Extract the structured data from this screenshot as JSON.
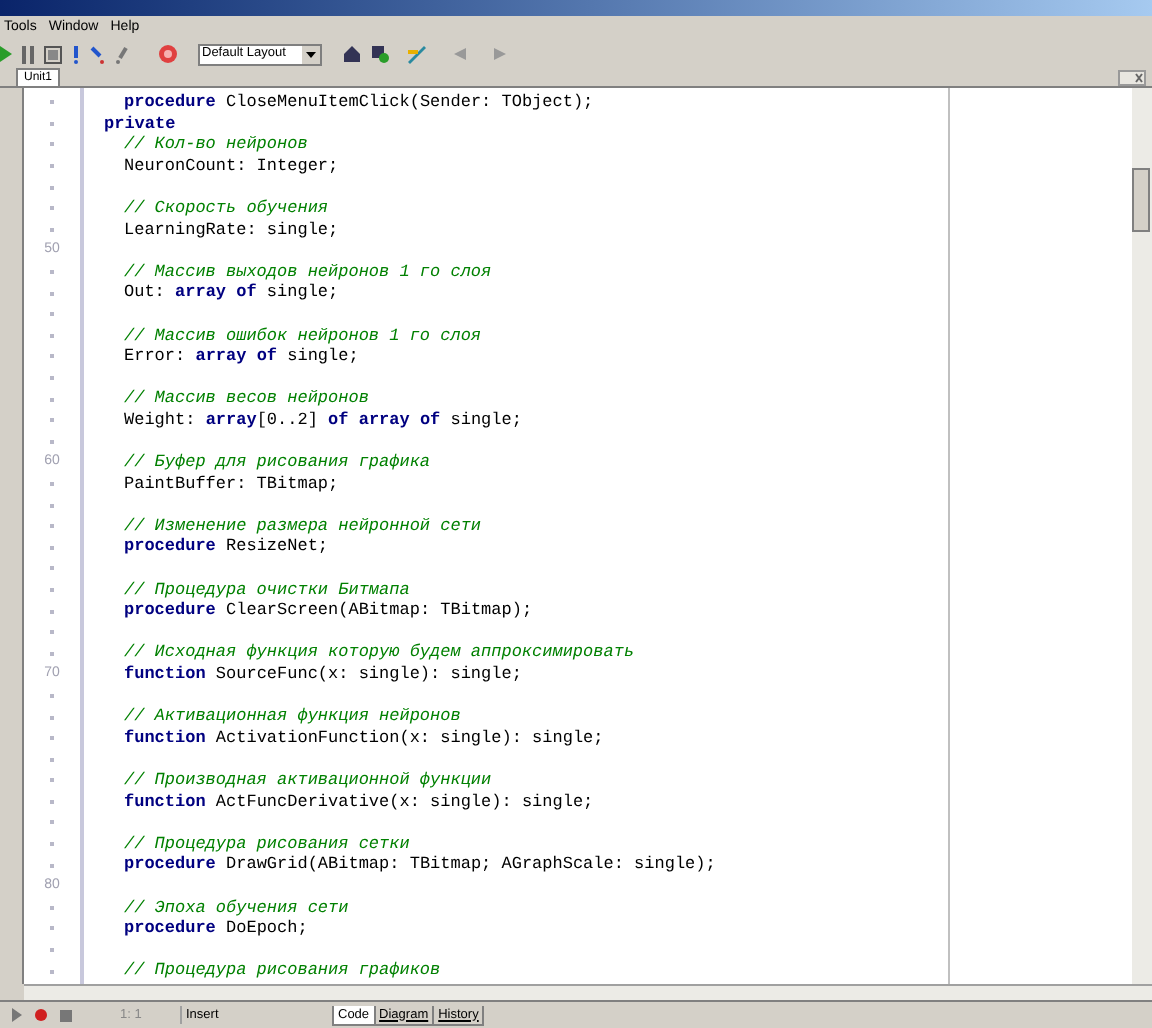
{
  "menu": [
    {
      "label": "Tools"
    },
    {
      "label": "Window"
    },
    {
      "label": "Help"
    }
  ],
  "toolbar": {
    "layout_combo": {
      "value": "Default Layout"
    }
  },
  "editor_tabs": [
    {
      "label": "Unit1",
      "selected": true
    }
  ],
  "lines": [
    {
      "kind": "member",
      "tokens": [
        {
          "kind": "keyword",
          "text": "procedure"
        },
        {
          "kind": "text",
          "text": " CloseMenuItemClick(Sender: TObject);"
        }
      ]
    },
    {
      "kind": "section",
      "tokens": [
        {
          "kind": "keyword",
          "text": "private"
        }
      ]
    },
    {
      "kind": "member",
      "tokens": [
        {
          "kind": "comment",
          "text": "// Кол-во нейронов"
        }
      ]
    },
    {
      "kind": "member",
      "tokens": [
        {
          "kind": "text",
          "text": "NeuronCount: Integer;"
        }
      ]
    },
    {
      "kind": "blank"
    },
    {
      "kind": "member",
      "tokens": [
        {
          "kind": "comment",
          "text": "// Скорость обучения"
        }
      ]
    },
    {
      "kind": "member",
      "tokens": [
        {
          "kind": "text",
          "text": "LearningRate: single;"
        }
      ]
    },
    {
      "kind": "blank",
      "number": "50"
    },
    {
      "kind": "member",
      "tokens": [
        {
          "kind": "comment",
          "text": "// Массив выходов нейронов 1 го слоя"
        }
      ]
    },
    {
      "kind": "member",
      "tokens": [
        {
          "kind": "text",
          "text": "Out: "
        },
        {
          "kind": "keyword",
          "text": "array of"
        },
        {
          "kind": "text",
          "text": " single;"
        }
      ]
    },
    {
      "kind": "blank"
    },
    {
      "kind": "member",
      "tokens": [
        {
          "kind": "comment",
          "text": "// Массив ошибок нейронов 1 го слоя"
        }
      ]
    },
    {
      "kind": "member",
      "tokens": [
        {
          "kind": "text",
          "text": "Error: "
        },
        {
          "kind": "keyword",
          "text": "array of"
        },
        {
          "kind": "text",
          "text": " single;"
        }
      ]
    },
    {
      "kind": "blank"
    },
    {
      "kind": "member",
      "tokens": [
        {
          "kind": "comment",
          "text": "// Массив весов нейронов"
        }
      ]
    },
    {
      "kind": "member",
      "tokens": [
        {
          "kind": "text",
          "text": "Weight: "
        },
        {
          "kind": "keyword",
          "text": "array"
        },
        {
          "kind": "text",
          "text": "[0..2] "
        },
        {
          "kind": "keyword",
          "text": "of array of"
        },
        {
          "kind": "text",
          "text": " single;"
        }
      ]
    },
    {
      "kind": "blank"
    },
    {
      "kind": "member",
      "number": "60",
      "tokens": [
        {
          "kind": "comment",
          "text": "// Буфер для рисования графика"
        }
      ]
    },
    {
      "kind": "member",
      "tokens": [
        {
          "kind": "text",
          "text": "PaintBuffer: TBitmap;"
        }
      ]
    },
    {
      "kind": "blank"
    },
    {
      "kind": "member",
      "tokens": [
        {
          "kind": "comment",
          "text": "// Изменение размера нейронной сети"
        }
      ]
    },
    {
      "kind": "member",
      "tokens": [
        {
          "kind": "keyword",
          "text": "procedure"
        },
        {
          "kind": "text",
          "text": " ResizeNet;"
        }
      ]
    },
    {
      "kind": "blank"
    },
    {
      "kind": "member",
      "tokens": [
        {
          "kind": "comment",
          "text": "// Процедура очистки Битмапа"
        }
      ]
    },
    {
      "kind": "member",
      "tokens": [
        {
          "kind": "keyword",
          "text": "procedure"
        },
        {
          "kind": "text",
          "text": " ClearScreen(ABitmap: TBitmap);"
        }
      ]
    },
    {
      "kind": "blank"
    },
    {
      "kind": "member",
      "tokens": [
        {
          "kind": "comment",
          "text": "// Исходная функция которую будем аппроксимировать"
        }
      ]
    },
    {
      "kind": "member",
      "number": "70",
      "tokens": [
        {
          "kind": "keyword",
          "text": "function"
        },
        {
          "kind": "text",
          "text": " SourceFunc(x: single): single;"
        }
      ]
    },
    {
      "kind": "blank"
    },
    {
      "kind": "member",
      "tokens": [
        {
          "kind": "comment",
          "text": "// Активационная функция нейронов"
        }
      ]
    },
    {
      "kind": "member",
      "tokens": [
        {
          "kind": "keyword",
          "text": "function"
        },
        {
          "kind": "text",
          "text": " ActivationFunction(x: single): single;"
        }
      ]
    },
    {
      "kind": "blank"
    },
    {
      "kind": "member",
      "tokens": [
        {
          "kind": "comment",
          "text": "// Производная активационной функции"
        }
      ]
    },
    {
      "kind": "member",
      "tokens": [
        {
          "kind": "keyword",
          "text": "function"
        },
        {
          "kind": "text",
          "text": " ActFuncDerivative(x: single): single;"
        }
      ]
    },
    {
      "kind": "blank"
    },
    {
      "kind": "member",
      "tokens": [
        {
          "kind": "comment",
          "text": "// Процедура рисования сетки"
        }
      ]
    },
    {
      "kind": "member",
      "tokens": [
        {
          "kind": "keyword",
          "text": "procedure"
        },
        {
          "kind": "text",
          "text": " DrawGrid(ABitmap: TBitmap; AGraphScale: single);"
        }
      ]
    },
    {
      "kind": "blank",
      "number": "80"
    },
    {
      "kind": "member",
      "tokens": [
        {
          "kind": "comment",
          "text": "// Эпоха обучения сети"
        }
      ]
    },
    {
      "kind": "member",
      "tokens": [
        {
          "kind": "keyword",
          "text": "procedure"
        },
        {
          "kind": "text",
          "text": " DoEpoch;"
        }
      ]
    },
    {
      "kind": "blank"
    },
    {
      "kind": "member",
      "tokens": [
        {
          "kind": "comment",
          "text": "// Процедура рисования графиков"
        }
      ]
    }
  ],
  "status_bar": {
    "position": "1: 1",
    "mode": "Insert",
    "view_tabs": [
      {
        "label": "Code",
        "selected": true
      },
      {
        "label": "Diagram",
        "selected": false
      },
      {
        "label": "History",
        "selected": false
      }
    ]
  }
}
